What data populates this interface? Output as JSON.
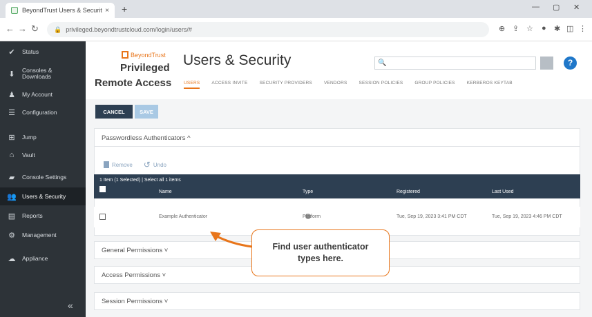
{
  "browser": {
    "tab_title": "BeyondTrust Users & Security",
    "url": "privileged.beyondtrustcloud.com/login/users/#",
    "new_tab": "+",
    "close_tab": "×"
  },
  "sidebar": {
    "items": [
      {
        "icon": "status-icon",
        "label": "Status"
      },
      {
        "icon": "download-icon",
        "label": "Consoles & Downloads"
      },
      {
        "icon": "user-icon",
        "label": "My Account"
      },
      {
        "icon": "configuration-icon",
        "label": "Configuration"
      },
      {
        "icon": "jump-icon",
        "label": "Jump"
      },
      {
        "icon": "vault-icon",
        "label": "Vault"
      },
      {
        "icon": "console-settings-icon",
        "label": "Console Settings"
      },
      {
        "icon": "users-icon",
        "label": "Users & Security"
      },
      {
        "icon": "reports-icon",
        "label": "Reports"
      },
      {
        "icon": "management-icon",
        "label": "Management"
      },
      {
        "icon": "appliance-icon",
        "label": "Appliance"
      }
    ],
    "active_index": 7,
    "collapse_glyph": "«"
  },
  "header": {
    "brand": "BeyondTrust",
    "product_line1": "Privileged",
    "product_line2": "Remote Access",
    "title": "Users & Security",
    "search_value": "",
    "help_glyph": "?",
    "tabs": [
      "USERS",
      "ACCESS INVITE",
      "SECURITY PROVIDERS",
      "VENDORS",
      "SESSION POLICIES",
      "GROUP POLICIES",
      "KERBEROS KEYTAB"
    ],
    "active_tab": 0
  },
  "buttons": {
    "cancel": "CANCEL",
    "save": "SAVE"
  },
  "sections": {
    "passwordless": "Passwordless Authenticators ^",
    "general": "General Permissions ˅",
    "access": "Access Permissions ˅",
    "session": "Session Permissions ˅"
  },
  "actions": {
    "remove": "Remove",
    "undo": "Undo"
  },
  "table": {
    "selection_bar": "1 Item (1 Selected) | Select all 1 items",
    "columns": [
      "Name",
      "Type",
      "Registered",
      "Last Used"
    ],
    "rows": [
      {
        "name": "Example Authenticator",
        "type": "Platform",
        "registered": "Tue, Sep 19, 2023 3:41 PM CDT",
        "last_used": "Tue, Sep 19, 2023 4:46 PM CDT"
      }
    ]
  },
  "callout": {
    "text": "Find user authenticator types here."
  },
  "colors": {
    "sidebar_bg": "#2d3338",
    "accent": "#e8751a",
    "table_header": "#2d3f52",
    "help_blue": "#1f77c9"
  }
}
